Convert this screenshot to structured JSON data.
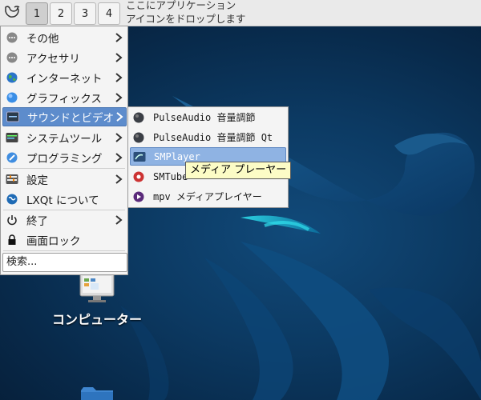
{
  "panel": {
    "workspaces": [
      "1",
      "2",
      "3",
      "4"
    ],
    "active_workspace": "1",
    "quicklaunch_hint_line1": "ここにアプリケーション",
    "quicklaunch_hint_line2": "アイコンをドロップします"
  },
  "main_menu": {
    "items": [
      {
        "label": "その他",
        "icon": "more-icon",
        "submenu": true
      },
      {
        "label": "アクセサリ",
        "icon": "accessories-icon",
        "submenu": true
      },
      {
        "label": "インターネット",
        "icon": "internet-globe-icon",
        "submenu": true
      },
      {
        "label": "グラフィックス",
        "icon": "graphics-icon",
        "submenu": true
      },
      {
        "label": "サウンドとビデオ",
        "icon": "multimedia-icon",
        "submenu": true,
        "selected": true
      },
      {
        "label": "システムツール",
        "icon": "system-tools-icon",
        "submenu": true
      },
      {
        "label": "プログラミング",
        "icon": "programming-icon",
        "submenu": true
      },
      {
        "label": "設定",
        "icon": "settings-icon",
        "submenu": true
      },
      {
        "label": "LXQt について",
        "icon": "lxqt-icon",
        "submenu": false
      },
      {
        "label": "終了",
        "icon": "power-icon",
        "submenu": true
      },
      {
        "label": "画面ロック",
        "icon": "lock-icon",
        "submenu": false
      }
    ],
    "search_placeholder": "検索..."
  },
  "submenu": {
    "items": [
      {
        "label": "PulseAudio 音量調節",
        "icon": "pulseaudio-icon"
      },
      {
        "label": "PulseAudio 音量調節 Qt",
        "icon": "pulseaudio-icon"
      },
      {
        "label": "SMPlayer",
        "icon": "smplayer-icon",
        "selected": true
      },
      {
        "label": "SMTube",
        "icon": "smtube-icon"
      },
      {
        "label": "mpv メディアプレイヤー",
        "icon": "mpv-icon"
      }
    ]
  },
  "tooltip": {
    "text": "メディア プレーヤー"
  },
  "desktop": {
    "icons": [
      {
        "label": "コンピューター",
        "icon": "computer-icon"
      },
      {
        "label": "",
        "icon": "folder-icon"
      }
    ]
  },
  "colors": {
    "menu_selected": "#5d8ccc",
    "submenu_selected": "#8fb3e3",
    "tooltip_bg": "#fcfcc6",
    "desktop_bg": "#0c3a63"
  }
}
